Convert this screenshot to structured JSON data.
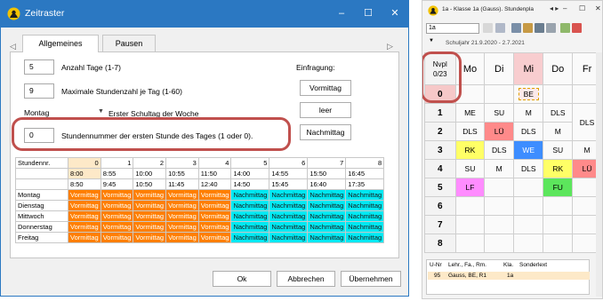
{
  "left_window": {
    "title": "Zeitraster",
    "controls": {
      "minimize": "–",
      "maximize": "☐",
      "close": "✕"
    },
    "tabs": [
      {
        "label": "Allgemeines"
      },
      {
        "label": "Pausen"
      }
    ],
    "tab_scroll_left": "◁",
    "tab_scroll_right": "▷",
    "fields": [
      {
        "value": "5",
        "label": "Anzahl Tage (1-7)"
      },
      {
        "value": "9",
        "label": "Maximale Stundenzahl je Tag (1-60)"
      },
      {
        "value": "0",
        "label": "Stundennummer der ersten Stunde des Tages (1 oder 0)."
      }
    ],
    "first_day": {
      "value": "Montag",
      "label": "Erster Schultag der Woche"
    },
    "einfragung": {
      "label": "Einfragung:",
      "buttons": [
        "Vormittag",
        "leer",
        "Nachmittag"
      ]
    },
    "grid": {
      "header_label": "Stundennr.",
      "hours": [
        "0",
        "1",
        "2",
        "3",
        "4",
        "5",
        "6",
        "7",
        "8"
      ],
      "start_times": [
        "8:00",
        "8:55",
        "10:00",
        "10:55",
        "11:50",
        "14:00",
        "14:55",
        "15:50",
        "16:45"
      ],
      "end_times": [
        "8:50",
        "9:45",
        "10:50",
        "11:45",
        "12:40",
        "14:50",
        "15:45",
        "16:40",
        "17:35"
      ],
      "days": [
        "Montag",
        "Dienstag",
        "Mittwoch",
        "Donnerstag",
        "Freitag"
      ],
      "vormittag_text": "Vormittag",
      "nachmittag_text": "Nachmittag",
      "vormittag_count": 5,
      "nachmittag_count": 4
    },
    "footer_buttons": {
      "ok": "Ok",
      "cancel": "Abbrechen",
      "apply": "Übernehmen"
    },
    "colors": {
      "titlebar": "#2b78c2",
      "vormittag": "#ff7f00",
      "nachmittag": "#00e8f2",
      "highlight": "#c0504d"
    }
  },
  "right_window": {
    "title": "1a - Klasse 1a (Gauss). Stundenpla",
    "nav_arrows": "◂ ▸",
    "controls": {
      "minimize": "–",
      "maximize": "☐",
      "close": "✕"
    },
    "class_combo": "1a",
    "date_range": "Schuljahr 21.9.2020 - 2.7.2021",
    "corner_label": "Nvpl",
    "corner_count": "0/23",
    "days": [
      "Mo",
      "Di",
      "Mi",
      "Do",
      "Fr"
    ],
    "hours": [
      "0",
      "1",
      "2",
      "3",
      "4",
      "5",
      "6",
      "7",
      "8"
    ],
    "lessons": [
      [
        "",
        "",
        "BE",
        "",
        ""
      ],
      [
        "ME",
        "SU",
        "M",
        "DLS",
        "DLS"
      ],
      [
        "DLS",
        "LÜ",
        "DLS",
        "M",
        ""
      ],
      [
        "RK",
        "DLS",
        "WE",
        "SU",
        "M"
      ],
      [
        "SU",
        "M",
        "DLS",
        "RK",
        "LÜ"
      ],
      [
        "LF",
        "",
        "",
        "FU",
        ""
      ],
      [
        "",
        "",
        "",
        "",
        ""
      ],
      [
        "",
        "",
        "",
        "",
        ""
      ],
      [
        "",
        "",
        "",
        "",
        ""
      ]
    ],
    "bottom_table": {
      "headers": [
        "U-Nr",
        "Lehr., Fa., Rm.",
        "Kla.",
        "Sonderlext"
      ],
      "row": [
        "95",
        "Gauss, BE, R1",
        "1a",
        ""
      ]
    },
    "colors": {
      "RK": "#ffff66",
      "LÜ": "#ff8a8a",
      "WE": "#3d8dff",
      "LF": "#ff8cff",
      "FU": "#5ce65c",
      "today_header": "#f8cdcf"
    }
  }
}
